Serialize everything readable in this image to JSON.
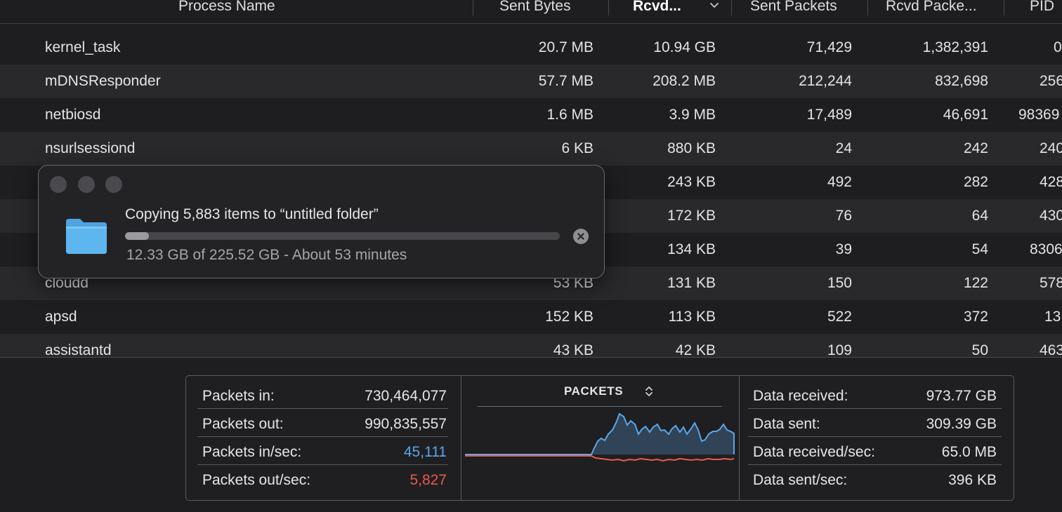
{
  "columns": {
    "process_name": "Process Name",
    "sent_bytes": "Sent Bytes",
    "rcvd_bytes": "Rcvd...",
    "sent_packets": "Sent Packets",
    "rcvd_packets": "Rcvd Packe...",
    "pid": "PID"
  },
  "rows": [
    {
      "name": "kernel_task",
      "sent_bytes": "20.7 MB",
      "rcvd_bytes": "10.94 GB",
      "sent_packets": "71,429",
      "rcvd_packets": "1,382,391",
      "pid": "0"
    },
    {
      "name": "mDNSResponder",
      "sent_bytes": "57.7 MB",
      "rcvd_bytes": "208.2 MB",
      "sent_packets": "212,244",
      "rcvd_packets": "832,698",
      "pid": "256"
    },
    {
      "name": "netbiosd",
      "sent_bytes": "1.6 MB",
      "rcvd_bytes": "3.9 MB",
      "sent_packets": "17,489",
      "rcvd_packets": "46,691",
      "pid": "98369"
    },
    {
      "name": "nsurlsessiond",
      "sent_bytes": "6 KB",
      "rcvd_bytes": "880 KB",
      "sent_packets": "24",
      "rcvd_packets": "242",
      "pid": "240"
    },
    {
      "name": "",
      "sent_bytes": "",
      "rcvd_bytes": "243 KB",
      "sent_packets": "492",
      "rcvd_packets": "282",
      "pid": "428"
    },
    {
      "name": "",
      "sent_bytes": "",
      "rcvd_bytes": "172 KB",
      "sent_packets": "76",
      "rcvd_packets": "64",
      "pid": "430"
    },
    {
      "name": "",
      "sent_bytes": "",
      "rcvd_bytes": "134 KB",
      "sent_packets": "39",
      "rcvd_packets": "54",
      "pid": "8306"
    },
    {
      "name": "cloudd",
      "sent_bytes": "53 KB",
      "rcvd_bytes": "131 KB",
      "sent_packets": "150",
      "rcvd_packets": "122",
      "pid": "578"
    },
    {
      "name": "apsd",
      "sent_bytes": "152 KB",
      "rcvd_bytes": "113 KB",
      "sent_packets": "522",
      "rcvd_packets": "372",
      "pid": "13"
    },
    {
      "name": "assistantd",
      "sent_bytes": "43 KB",
      "rcvd_bytes": "42 KB",
      "sent_packets": "109",
      "rcvd_packets": "50",
      "pid": "463"
    }
  ],
  "packets": {
    "in_label": "Packets in:",
    "in_value": "730,464,077",
    "out_label": "Packets out:",
    "out_value": "990,835,557",
    "in_sec_label": "Packets in/sec:",
    "in_sec_value": "45,111",
    "out_sec_label": "Packets out/sec:",
    "out_sec_value": "5,827"
  },
  "graph": {
    "title": "PACKETS",
    "in_color": "#5aa6ea",
    "out_color": "#e9594c"
  },
  "data": {
    "received_label": "Data received:",
    "received_value": "973.77 GB",
    "sent_label": "Data sent:",
    "sent_value": "309.39 GB",
    "received_sec_label": "Data received/sec:",
    "received_sec_value": "65.0 MB",
    "sent_sec_label": "Data sent/sec:",
    "sent_sec_value": "396 KB"
  },
  "copy_dialog": {
    "title": "Copying 5,883 items to “untitled folder”",
    "status": "12.33 GB of 225.52 GB - About 53 minutes",
    "progress": 0.055,
    "folder_icon": "folder-icon",
    "folder_color": "#5eb6ee"
  }
}
